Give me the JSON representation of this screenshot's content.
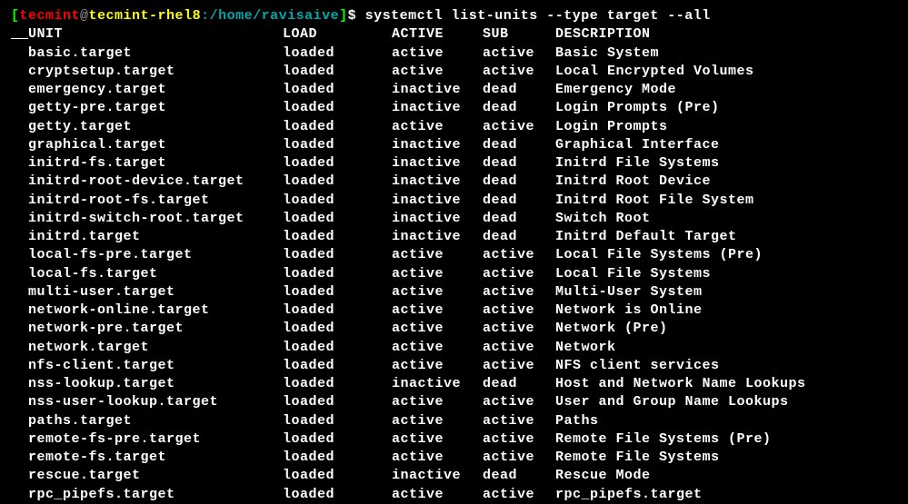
{
  "prompt": {
    "bracket_open": "[",
    "user": "tecmint",
    "at": "@",
    "host": "tecmint-rhel8",
    "colon": ":",
    "path": "/home/ravisaive",
    "bracket_close": "]",
    "dollar": "$",
    "command": "systemctl list-units --type target --all"
  },
  "headers": {
    "unit": "UNIT",
    "load": "LOAD",
    "active": "ACTIVE",
    "sub": "SUB",
    "description": "DESCRIPTION"
  },
  "rows": [
    {
      "unit": "basic.target",
      "load": "loaded",
      "active": "active",
      "sub": "active",
      "desc": "Basic System"
    },
    {
      "unit": "cryptsetup.target",
      "load": "loaded",
      "active": "active",
      "sub": "active",
      "desc": "Local Encrypted Volumes"
    },
    {
      "unit": "emergency.target",
      "load": "loaded",
      "active": "inactive",
      "sub": "dead",
      "desc": "Emergency Mode"
    },
    {
      "unit": "getty-pre.target",
      "load": "loaded",
      "active": "inactive",
      "sub": "dead",
      "desc": "Login Prompts (Pre)"
    },
    {
      "unit": "getty.target",
      "load": "loaded",
      "active": "active",
      "sub": "active",
      "desc": "Login Prompts"
    },
    {
      "unit": "graphical.target",
      "load": "loaded",
      "active": "inactive",
      "sub": "dead",
      "desc": "Graphical Interface"
    },
    {
      "unit": "initrd-fs.target",
      "load": "loaded",
      "active": "inactive",
      "sub": "dead",
      "desc": "Initrd File Systems"
    },
    {
      "unit": "initrd-root-device.target",
      "load": "loaded",
      "active": "inactive",
      "sub": "dead",
      "desc": "Initrd Root Device"
    },
    {
      "unit": "initrd-root-fs.target",
      "load": "loaded",
      "active": "inactive",
      "sub": "dead",
      "desc": "Initrd Root File System"
    },
    {
      "unit": "initrd-switch-root.target",
      "load": "loaded",
      "active": "inactive",
      "sub": "dead",
      "desc": "Switch Root"
    },
    {
      "unit": "initrd.target",
      "load": "loaded",
      "active": "inactive",
      "sub": "dead",
      "desc": "Initrd Default Target"
    },
    {
      "unit": "local-fs-pre.target",
      "load": "loaded",
      "active": "active",
      "sub": "active",
      "desc": "Local File Systems (Pre)"
    },
    {
      "unit": "local-fs.target",
      "load": "loaded",
      "active": "active",
      "sub": "active",
      "desc": "Local File Systems"
    },
    {
      "unit": "multi-user.target",
      "load": "loaded",
      "active": "active",
      "sub": "active",
      "desc": "Multi-User System"
    },
    {
      "unit": "network-online.target",
      "load": "loaded",
      "active": "active",
      "sub": "active",
      "desc": "Network is Online"
    },
    {
      "unit": "network-pre.target",
      "load": "loaded",
      "active": "active",
      "sub": "active",
      "desc": "Network (Pre)"
    },
    {
      "unit": "network.target",
      "load": "loaded",
      "active": "active",
      "sub": "active",
      "desc": "Network"
    },
    {
      "unit": "nfs-client.target",
      "load": "loaded",
      "active": "active",
      "sub": "active",
      "desc": "NFS client services"
    },
    {
      "unit": "nss-lookup.target",
      "load": "loaded",
      "active": "inactive",
      "sub": "dead",
      "desc": "Host and Network Name Lookups"
    },
    {
      "unit": "nss-user-lookup.target",
      "load": "loaded",
      "active": "active",
      "sub": "active",
      "desc": "User and Group Name Lookups"
    },
    {
      "unit": "paths.target",
      "load": "loaded",
      "active": "active",
      "sub": "active",
      "desc": "Paths"
    },
    {
      "unit": "remote-fs-pre.target",
      "load": "loaded",
      "active": "active",
      "sub": "active",
      "desc": "Remote File Systems (Pre)"
    },
    {
      "unit": "remote-fs.target",
      "load": "loaded",
      "active": "active",
      "sub": "active",
      "desc": "Remote File Systems"
    },
    {
      "unit": "rescue.target",
      "load": "loaded",
      "active": "inactive",
      "sub": "dead",
      "desc": "Rescue Mode"
    },
    {
      "unit": "rpc_pipefs.target",
      "load": "loaded",
      "active": "active",
      "sub": "active",
      "desc": "rpc_pipefs.target"
    }
  ]
}
